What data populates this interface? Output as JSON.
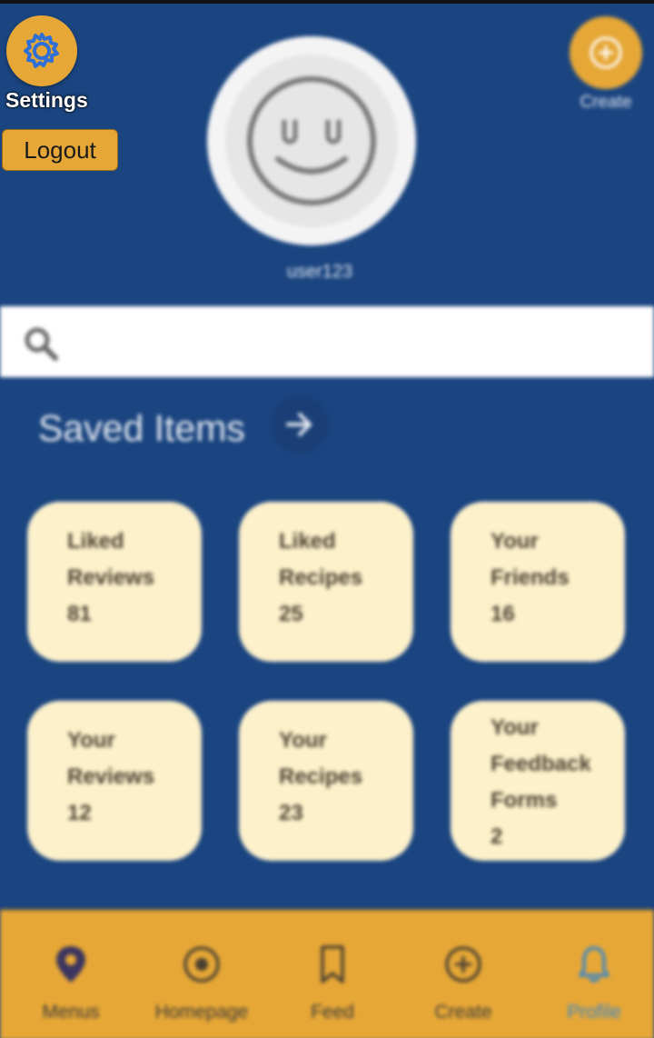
{
  "header": {
    "settings_label": "Settings",
    "logout_label": "Logout",
    "username": "user123",
    "create_label": "Create"
  },
  "search": {
    "placeholder": ""
  },
  "saved": {
    "title": "Saved Items",
    "cards": [
      {
        "line1": "Liked",
        "line2": "Reviews",
        "count": "81"
      },
      {
        "line1": "Liked",
        "line2": "Recipes",
        "count": "25"
      },
      {
        "line1": "Your",
        "line2": "Friends",
        "count": "16"
      },
      {
        "line1": "Your",
        "line2": "Reviews",
        "count": "12"
      },
      {
        "line1": "Your",
        "line2": "Recipes",
        "count": "23"
      },
      {
        "line1": "Your",
        "line2": "Feedback",
        "line3": "Forms",
        "count": "2"
      }
    ]
  },
  "nav": {
    "items": [
      {
        "label": "Menus",
        "icon": "map-pin-icon"
      },
      {
        "label": "Homepage",
        "icon": "home-circle-icon"
      },
      {
        "label": "Feed",
        "icon": "bookmark-icon"
      },
      {
        "label": "Create",
        "icon": "plus-circle-icon"
      },
      {
        "label": "Profile",
        "icon": "bell-icon",
        "active": true
      }
    ],
    "active_color": "#3a86c8"
  },
  "colors": {
    "background": "#1b4580",
    "accent": "#e6a736",
    "card": "#fdf1cb"
  }
}
